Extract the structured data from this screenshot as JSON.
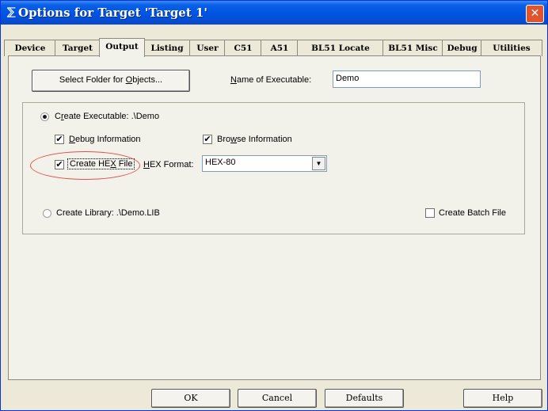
{
  "window": {
    "title": "Options for Target 'Target 1'",
    "icon": "keil-target-icon",
    "close_glyph": "✕"
  },
  "tabs": [
    {
      "label": "Device"
    },
    {
      "label": "Target"
    },
    {
      "label": "Output"
    },
    {
      "label": "Listing"
    },
    {
      "label": "User"
    },
    {
      "label": "C51"
    },
    {
      "label": "A51"
    },
    {
      "label": "BL51 Locate"
    },
    {
      "label": "BL51 Misc"
    },
    {
      "label": "Debug"
    },
    {
      "label": "Utilities"
    }
  ],
  "active_tab": "Output",
  "output": {
    "select_folder_button": {
      "before": "Select Folder for ",
      "underlined": "O",
      "after": "bjects..."
    },
    "name_of_executable": {
      "underlined": "N",
      "label_rest": "ame of Executable:",
      "value": "Demo"
    },
    "create_executable": {
      "before": "C",
      "underlined": "r",
      "after": "eate Executable:  .\\Demo",
      "selected": true
    },
    "debug_information": {
      "underlined": "D",
      "after": "ebug Information",
      "checked": true
    },
    "browse_information": {
      "before": "Bro",
      "underlined": "w",
      "after": "se Information",
      "checked": true
    },
    "create_hex_file": {
      "before": "Create HE",
      "underlined": "X",
      "after": " File",
      "checked": true
    },
    "hex_format": {
      "underlined": "H",
      "label_rest": "EX Format:",
      "value": "HEX-80"
    },
    "create_library": {
      "text": "Create Library:  .\\Demo.LIB",
      "selected": false
    },
    "create_batch_file": {
      "text": "Create Batch File",
      "checked": false
    },
    "check_glyph": "✔",
    "arrow_glyph": "▼"
  },
  "footer": {
    "ok": "OK",
    "cancel": "Cancel",
    "defaults": "Defaults",
    "help": "Help"
  },
  "colors": {
    "title_bar": "#0054e3",
    "annotation": "#e05050",
    "dialog_bg": "#ece9d8"
  }
}
